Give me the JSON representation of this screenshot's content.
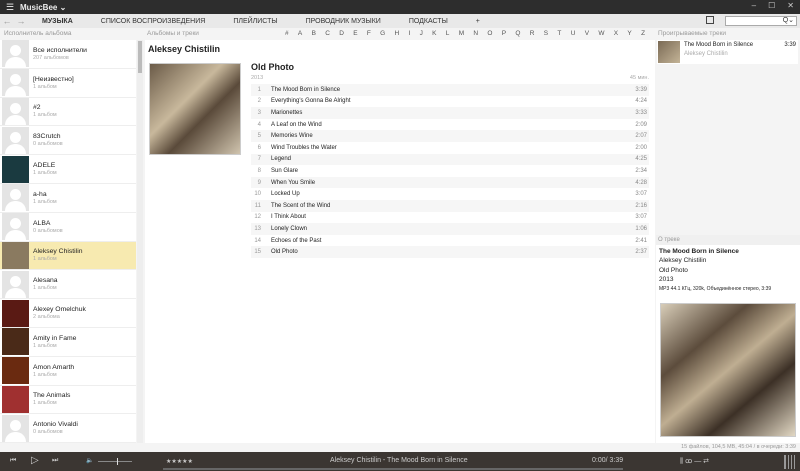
{
  "app": {
    "title": "MusicBee ⌄",
    "window_buttons": [
      "–",
      "☐",
      "✕"
    ]
  },
  "tabs": [
    "МУЗЫКА",
    "СПИСОК ВОСПРОИЗВЕДЕНИЯ",
    "ПЛЕЙЛИСТЫ",
    "ПРОВОДНИК МУЗЫКИ",
    "ПОДКАСТЫ",
    "+"
  ],
  "search": {
    "icon": "Q⌄"
  },
  "headers": {
    "artists": "Исполнитель альбома",
    "albums": "Альбомы и треки",
    "now_playing": "Проигрываемые треки",
    "about": "О треке"
  },
  "alphabet": [
    "#",
    "A",
    "B",
    "C",
    "D",
    "E",
    "F",
    "G",
    "H",
    "I",
    "J",
    "K",
    "L",
    "M",
    "N",
    "O",
    "P",
    "Q",
    "R",
    "S",
    "T",
    "U",
    "V",
    "W",
    "X",
    "Y",
    "Z"
  ],
  "artists": [
    {
      "name": "Все исполнители",
      "count": "207 альбомов"
    },
    {
      "name": "[Неизвестно]",
      "count": "1 альбом"
    },
    {
      "name": "#2",
      "count": "1 альбом"
    },
    {
      "name": "83Crutch",
      "count": "0 альбомов"
    },
    {
      "name": "ADELE",
      "count": "1 альбом",
      "art": "#1a3a40"
    },
    {
      "name": "a-ha",
      "count": "1 альбом"
    },
    {
      "name": "ALBA",
      "count": "0 альбомов"
    },
    {
      "name": "Aleksey Chistilin",
      "count": "1 альбом",
      "art": "#8a7a60",
      "selected": true
    },
    {
      "name": "Alesana",
      "count": "1 альбом"
    },
    {
      "name": "Alexey Omelchuk",
      "count": "2 альбома",
      "art": "#5a1a14"
    },
    {
      "name": "Amity in Fame",
      "count": "1 альбом",
      "art": "#4a2a18"
    },
    {
      "name": "Amon Amarth",
      "count": "1 альбом",
      "art": "#6a2a10"
    },
    {
      "name": "The Animals",
      "count": "1 альбом",
      "art": "#a03030"
    },
    {
      "name": "Antonio Vivaldi",
      "count": "0 альбомов"
    }
  ],
  "main": {
    "artist": "Aleksey Chistilin",
    "album": "Old Photo",
    "year": "2013",
    "total": "45 мин.",
    "tracks": [
      [
        "1",
        "The Mood Born in Silence",
        "3:39"
      ],
      [
        "2",
        "Everything's Gonna Be Alright",
        "4:24"
      ],
      [
        "3",
        "Marionettes",
        "3:33"
      ],
      [
        "4",
        "A Leaf on the Wind",
        "2:09"
      ],
      [
        "5",
        "Memories Wine",
        "2:07"
      ],
      [
        "6",
        "Wind Troubles the Water",
        "2:00"
      ],
      [
        "7",
        "Legend",
        "4:25"
      ],
      [
        "8",
        "Sun Glare",
        "2:34"
      ],
      [
        "9",
        "When You Smile",
        "4:28"
      ],
      [
        "10",
        "Locked Up",
        "3:07"
      ],
      [
        "11",
        "The Scent of the Wind",
        "2:16"
      ],
      [
        "12",
        "I Think About",
        "3:07"
      ],
      [
        "13",
        "Lonely Clown",
        "1:06"
      ],
      [
        "14",
        "Echoes of the Past",
        "2:41"
      ],
      [
        "15",
        "Old Photo",
        "2:37"
      ]
    ]
  },
  "now_playing": {
    "title": "The Mood Born in Silence",
    "artist": "Aleksey Chistilin",
    "duration": "3:39"
  },
  "about": {
    "title": "The Mood Born in Silence",
    "artist": "Aleksey Chistilin",
    "album": "Old Photo",
    "year": "2013",
    "format": "MP3 44.1 КГц, 320k, Объединённое стерео, 3:39"
  },
  "status": "15 файлов, 104,5 MB, 45:04 /   в очереди: 3:39",
  "player": {
    "prev": "⏮",
    "play": "▷",
    "next": "⏭",
    "volume_icon": "🔈",
    "rating": "★★★★★",
    "track": "Aleksey Chistilin - The Mood Born in Silence",
    "time": "0:00/ 3:39",
    "extras": "⫼  ꝏ  —  ⇄",
    "volume": 0.55,
    "progress": 0.0
  }
}
